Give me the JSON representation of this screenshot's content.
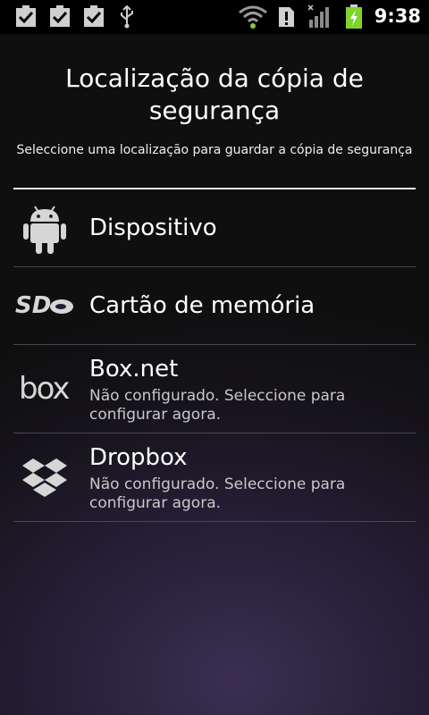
{
  "status_bar": {
    "time": "9:38",
    "icons": [
      "checkbox-notification-icon",
      "checkbox-notification-icon",
      "checkbox-notification-icon",
      "usb-icon",
      "wifi-icon",
      "alert-icon",
      "signal-icon",
      "battery-charging-icon"
    ]
  },
  "dialog": {
    "title": "Localização da cópia de segurança",
    "subtitle": "Seleccione uma localização para guardar a cópia de segurança"
  },
  "locations": [
    {
      "label": "Dispositivo",
      "icon": "android-icon"
    },
    {
      "label": "Cartão de memória",
      "icon": "sd-card-icon"
    },
    {
      "label": "Box.net",
      "description": "Não configurado. Seleccione para configurar agora.",
      "icon": "box-logo-icon"
    },
    {
      "label": "Dropbox",
      "description": "Não configurado. Seleccione para configurar agora.",
      "icon": "dropbox-logo-icon"
    }
  ],
  "colors": {
    "divider": "#f0f0f0",
    "list_separator": "#4a4652",
    "battery_green": "#7fd52b",
    "wifi_green": "#8bc34a"
  }
}
